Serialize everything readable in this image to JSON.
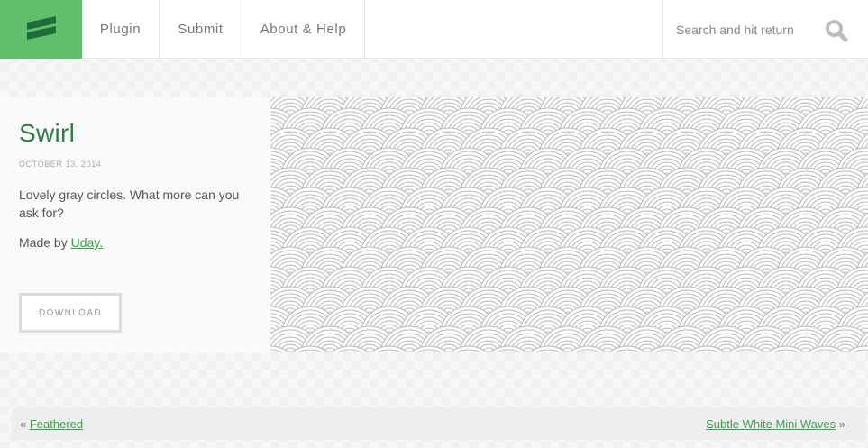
{
  "nav": {
    "items": [
      {
        "label": "Plugin"
      },
      {
        "label": "Submit"
      },
      {
        "label": "About & Help"
      }
    ]
  },
  "search": {
    "placeholder": "Search and hit return"
  },
  "pattern": {
    "title": "Swirl",
    "date": "OCTOBER 13, 2014",
    "description": "Lovely gray circles. What more can you ask for?",
    "made_by_prefix": "Made by ",
    "author": "Uday.",
    "download_label": "DOWNLOAD"
  },
  "pager": {
    "prev_arrow": "«",
    "prev_label": "Feathered",
    "next_label": "Subtle White Mini Waves",
    "next_arrow": "»"
  },
  "colors": {
    "brand": "#5fbf6d",
    "link": "#3aa04c",
    "title": "#2e7d4a"
  }
}
